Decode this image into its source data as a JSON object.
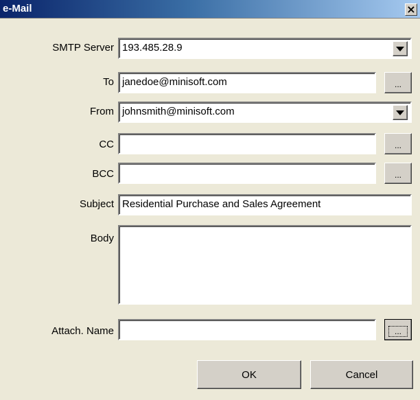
{
  "window": {
    "title": "e-Mail",
    "close_glyph": "×"
  },
  "form": {
    "smtp_label": "SMTP Server",
    "smtp_value": "193.485.28.9",
    "to_label": "To",
    "to_value": "janedoe@minisoft.com",
    "from_label": "From",
    "from_value": "johnsmith@minisoft.com",
    "cc_label": "CC",
    "cc_value": "",
    "bcc_label": "BCC",
    "bcc_value": "",
    "subject_label": "Subject",
    "subject_value": "Residential Purchase and Sales Agreement",
    "body_label": "Body",
    "body_value": "",
    "attach_label": "Attach. Name",
    "attach_value": "",
    "browse_label": "..."
  },
  "buttons": {
    "ok_label": "OK",
    "cancel_label": "Cancel"
  },
  "icons": [
    "close-icon",
    "dropdown-arrow-icon"
  ],
  "colors": {
    "dialog_bg": "#ece9d8",
    "titlebar_start": "#0a246a",
    "titlebar_end": "#a6caf0"
  }
}
